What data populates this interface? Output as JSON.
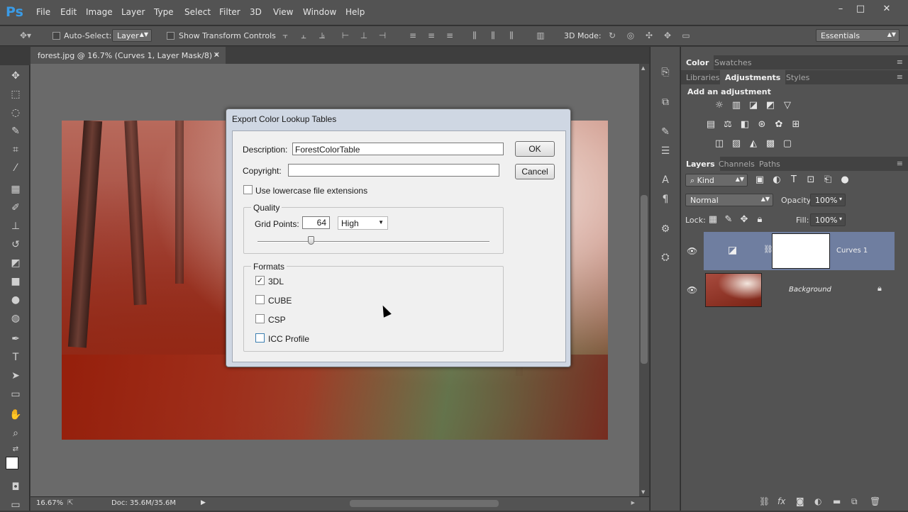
{
  "app": {
    "logo": "Ps",
    "menu": [
      "File",
      "Edit",
      "Image",
      "Layer",
      "Type",
      "Select",
      "Filter",
      "3D",
      "View",
      "Window",
      "Help"
    ],
    "window_controls": [
      "–",
      "□",
      "✕"
    ]
  },
  "options_bar": {
    "auto_select_label": "Auto-Select:",
    "auto_select_value": "Layer",
    "show_transform_label": "Show Transform Controls",
    "mode_3d_label": "3D Mode:",
    "workspace": "Essentials"
  },
  "document": {
    "tab_title": "forest.jpg @ 16.7% (Curves 1, Layer Mask/8) *",
    "close_glyph": "✕",
    "zoom": "16.67%",
    "doc_info": "Doc: 35.6M/35.6M"
  },
  "dialog": {
    "title": "Export Color Lookup Tables",
    "description_label": "Description:",
    "description_value": "ForestColorTable",
    "copyright_label": "Copyright:",
    "copyright_value": "",
    "ok_label": "OK",
    "cancel_label": "Cancel",
    "lowercase_label": "Use lowercase file extensions",
    "lowercase_checked": false,
    "quality": {
      "group_label": "Quality",
      "grid_points_label": "Grid Points:",
      "grid_points_value": "64",
      "quality_select": "High",
      "slider_fraction": 0.23
    },
    "formats": {
      "group_label": "Formats",
      "items": [
        {
          "label": "3DL",
          "checked": true
        },
        {
          "label": "CUBE",
          "checked": false
        },
        {
          "label": "CSP",
          "checked": false
        },
        {
          "label": "ICC Profile",
          "checked": false
        }
      ]
    }
  },
  "panels": {
    "color_tabs": [
      "Color",
      "Swatches"
    ],
    "adjust_tabs": [
      "Libraries",
      "Adjustments",
      "Styles"
    ],
    "adjust_heading": "Add an adjustment",
    "layers_tabs": [
      "Layers",
      "Channels",
      "Paths"
    ],
    "kind_label": "Kind",
    "blend_mode": "Normal",
    "opacity_label": "Opacity:",
    "opacity_value": "100%",
    "lock_label": "Lock:",
    "fill_label": "Fill:",
    "fill_value": "100%",
    "layers": [
      {
        "name": "Curves 1",
        "selected": true
      },
      {
        "name": "Background",
        "selected": false
      }
    ]
  }
}
